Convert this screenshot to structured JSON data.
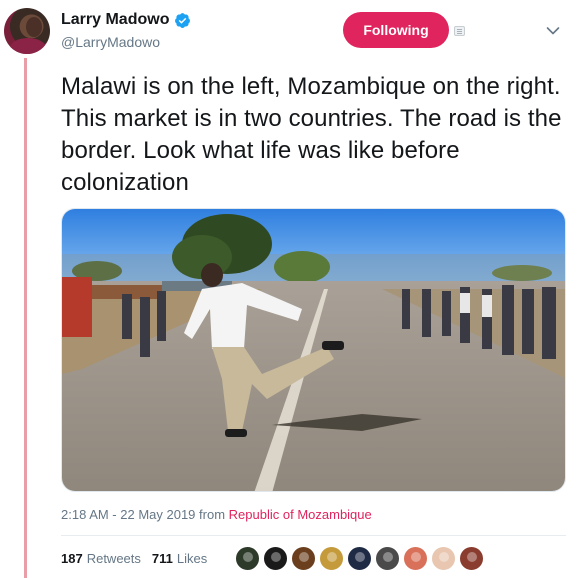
{
  "author": {
    "display_name": "Larry Madowo",
    "handle": "@LarryMadowo",
    "verified": true
  },
  "follow_button": {
    "label": "Following",
    "color": "#e0245e"
  },
  "tweet": {
    "text": "Malawi is on the left, Mozambique on the right. This market is in two countries. The road is the border. Look what life was like before colonization"
  },
  "media": {
    "description_icon": "photo"
  },
  "meta": {
    "time": "2:18 AM - 22 May 2019",
    "from": "from",
    "place": "Republic of Mozambique"
  },
  "stats": {
    "retweets_count": "187",
    "retweets_label": "Retweets",
    "likes_count": "711",
    "likes_label": "Likes"
  },
  "likers": [
    {
      "color": "#2d3a2a"
    },
    {
      "color": "#1a1a1a"
    },
    {
      "color": "#6b3f1e"
    },
    {
      "color": "#c49a3a"
    },
    {
      "color": "#1f2a44"
    },
    {
      "color": "#4a4a4a"
    },
    {
      "color": "#d9705a"
    },
    {
      "color": "#e8c6b0"
    },
    {
      "color": "#8a3c2e"
    }
  ],
  "colors": {
    "accent": "#e0245e",
    "thread_line": "#e89da7",
    "secondary_text": "#657786",
    "verified": "#1da1f2"
  }
}
